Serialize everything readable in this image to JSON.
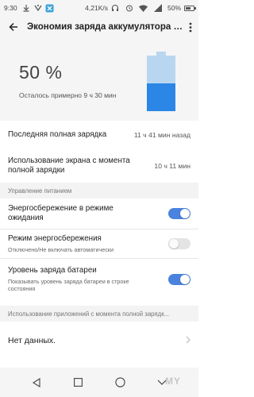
{
  "status_bar": {
    "time": "9:30",
    "speed": "4,21K/s",
    "battery_text": "50%",
    "battery_level": 0.5
  },
  "header": {
    "title": "Экономия заряда аккумулятора и...",
    "back_icon": "arrow-left-icon",
    "menu_icon": "more-vert-icon"
  },
  "summary": {
    "percent": "50 %",
    "remaining": "Осталось примерно 9 ч 30 мин",
    "battery_level": 0.5,
    "battery_color": "#2b86e6",
    "battery_empty_color": "#b9d6f1"
  },
  "rows": {
    "last_full_charge": {
      "title": "Последняя полная зарядка",
      "value": "11 ч 41 мин назад"
    },
    "screen_usage": {
      "title": "Использование экрана с момента полной зарядки",
      "value": "10 ч 11 мин"
    }
  },
  "power_management": {
    "header": "Управление питанием",
    "standby": {
      "title": "Энергосбережение в режиме ожидания",
      "on": true
    },
    "power_saving": {
      "title": "Режим энергосбережения",
      "subtitle": "Отключено/Не включать автоматически",
      "on": false
    },
    "battery_level": {
      "title": "Уровень заряда батареи",
      "subtitle": "Показывать уровень заряда батареи в строке состояния",
      "on": true
    }
  },
  "app_usage": {
    "header": "Использование приложений с момента полной зарядк...",
    "no_data": "Нет данных."
  },
  "colors": {
    "accent": "#4a83df"
  },
  "watermark": "MY"
}
